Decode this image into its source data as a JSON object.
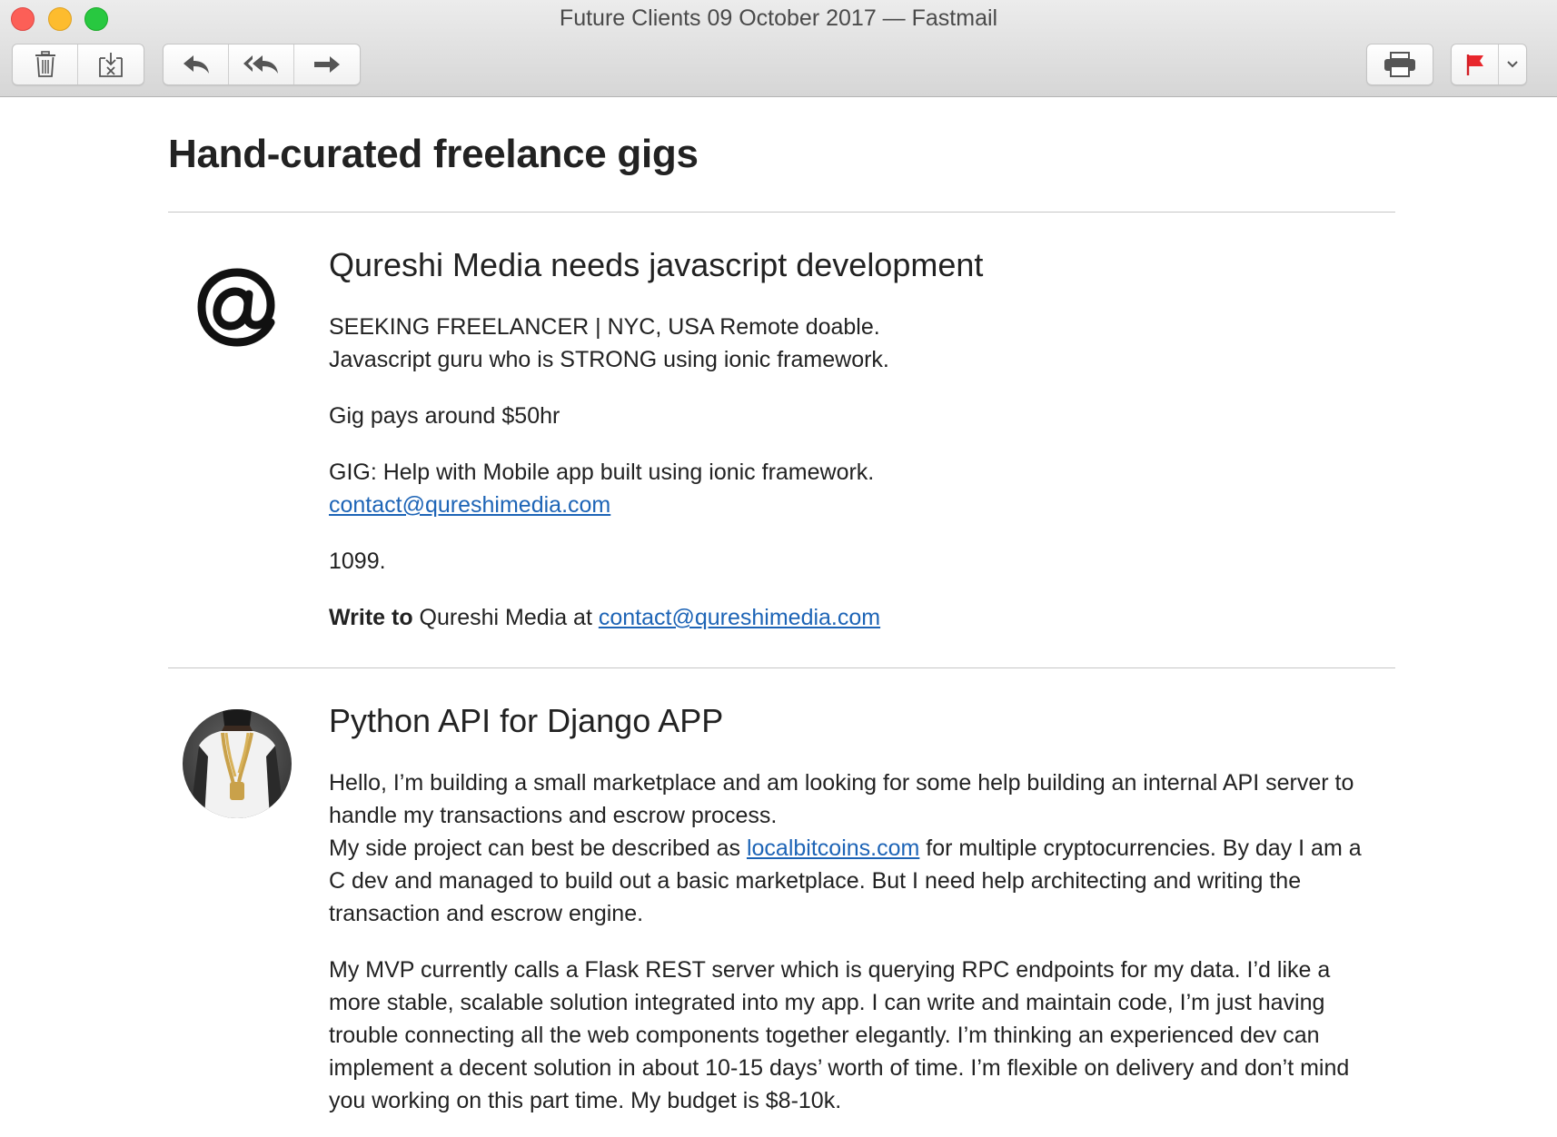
{
  "window": {
    "title": "Future Clients 09 October 2017 — Fastmail"
  },
  "toolbar": {
    "buttons": {
      "delete": "trash-icon",
      "junk": "junk-icon",
      "reply": "reply-icon",
      "reply_all": "reply-all-icon",
      "forward": "forward-icon",
      "print": "print-icon",
      "flag": "flag-icon",
      "flag_menu": "chevron-down-icon"
    },
    "flag_color": "#e8262c"
  },
  "message": {
    "heading": "Hand-curated freelance gigs",
    "link_color": "#1d64b6",
    "gigs": [
      {
        "title": "Qureshi Media needs javascript development",
        "avatar": "at-sign-logo",
        "line1": "SEEKING FREELANCER | NYC, USA Remote doable.",
        "line2": "Javascript guru who is STRONG using ionic framework.",
        "pay": "Gig pays around $50hr",
        "gig_line": "GIG: Help with Mobile app built using ionic framework.",
        "email_link": "contact@qureshimedia.com",
        "note": "1099.",
        "write_label": "Write to",
        "write_text": " Qureshi Media at ",
        "write_email": "contact@qureshimedia.com"
      },
      {
        "title": "Python API for Django APP",
        "avatar": "person-photo",
        "p1": "Hello, I’m building a small marketplace and am looking for some help building an internal API server to handle my transactions and escrow process.",
        "p2_before": "My side project can best be described as ",
        "p2_link": "localbitcoins.com",
        "p2_after": " for multiple cryptocurrencies. By day I am a C dev and managed to build out a basic marketplace. But I need help architecting and writing the transaction and escrow engine.",
        "p3": "My MVP currently calls a Flask REST server which is querying RPC endpoints for my data. I’d like a more stable, scalable solution integrated into my app. I can write and maintain code, I’m just having trouble connecting all the web components together elegantly. I’m thinking an experienced dev can implement a decent solution in about 10-15 days’ worth of time. I’m flexible on delivery and don’t mind you working on this part time. My budget is $8-10k."
      }
    ]
  }
}
